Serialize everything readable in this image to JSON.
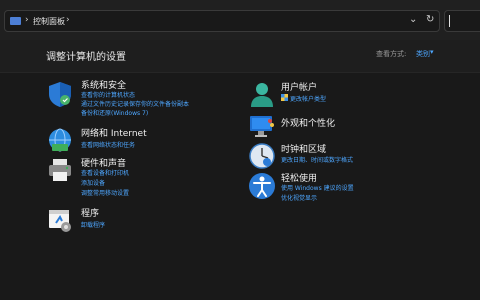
{
  "address_bar": {
    "breadcrumb": "控制面板",
    "sep": "›"
  },
  "header": {
    "title": "调整计算机的设置",
    "view_by_label": "查看方式:",
    "view_by_value": "类别",
    "view_caret": "▾"
  },
  "categories": [
    {
      "title": "系统和安全",
      "links": [
        "查看你的计算机状态",
        "通过文件历史记录保存你的文件备份副本",
        "备份和还原(Windows 7)"
      ]
    },
    {
      "title": "网络和 Internet",
      "links": [
        "查看网络状态和任务"
      ]
    },
    {
      "title": "硬件和声音",
      "links": [
        "查看设备和打印机",
        "添加设备",
        "调整常用移动设置"
      ]
    },
    {
      "title": "程序",
      "links": [
        "卸载程序"
      ]
    },
    {
      "title": "用户帐户",
      "links": [
        "更改帐户类型"
      ]
    },
    {
      "title": "外观和个性化",
      "links": []
    },
    {
      "title": "时钟和区域",
      "links": [
        "更改日期、时间或数字格式"
      ]
    },
    {
      "title": "轻松使用",
      "links": [
        "使用 Windows 建议的设置",
        "优化视觉显示"
      ]
    }
  ],
  "colors": {
    "link": "#4ea7ff",
    "background": "#191919"
  }
}
